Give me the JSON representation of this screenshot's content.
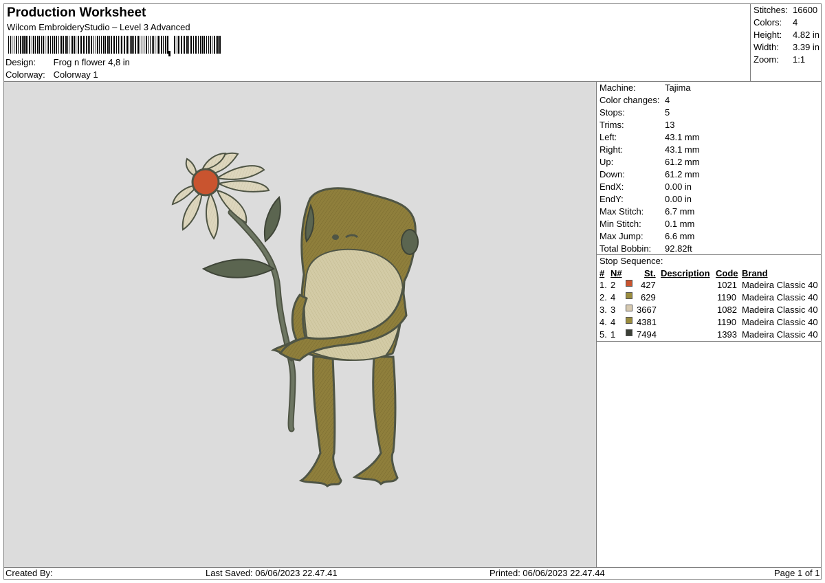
{
  "header": {
    "title": "Production Worksheet",
    "subtitle": "Wilcom EmbroideryStudio – Level 3 Advanced",
    "design_label": "Design:",
    "design_value": "Frog n flower 4,8 in",
    "colorway_label": "Colorway:",
    "colorway_value": "Colorway 1"
  },
  "summary": [
    {
      "label": "Stitches:",
      "value": "16600"
    },
    {
      "label": "Colors:",
      "value": "4"
    },
    {
      "label": "Height:",
      "value": "4.82 in"
    },
    {
      "label": "Width:",
      "value": "3.39 in"
    },
    {
      "label": "Zoom:",
      "value": "1:1"
    }
  ],
  "machine_info": [
    {
      "label": "Machine:",
      "value": "Tajima"
    },
    {
      "label": "Color changes:",
      "value": "4"
    },
    {
      "label": "Stops:",
      "value": "5"
    },
    {
      "label": "Trims:",
      "value": "13"
    },
    {
      "label": "Left:",
      "value": "43.1 mm"
    },
    {
      "label": "Right:",
      "value": "43.1 mm"
    },
    {
      "label": "Up:",
      "value": "61.2 mm"
    },
    {
      "label": "Down:",
      "value": "61.2 mm"
    },
    {
      "label": "EndX:",
      "value": "0.00 in"
    },
    {
      "label": "EndY:",
      "value": "0.00 in"
    },
    {
      "label": "Max Stitch:",
      "value": "6.7 mm"
    },
    {
      "label": "Min Stitch:",
      "value": "0.1 mm"
    },
    {
      "label": "Max Jump:",
      "value": "6.6 mm"
    },
    {
      "label": "Total Bobbin:",
      "value": "92.82ft"
    }
  ],
  "stop_sequence": {
    "title": "Stop Sequence:",
    "headers": {
      "num": "#",
      "n": "N#",
      "st": "St.",
      "description": "Description",
      "code": "Code",
      "brand": "Brand"
    },
    "rows": [
      {
        "num": "1.",
        "n": "2",
        "color": "#c9542f",
        "st": "427",
        "code": "1021",
        "brand": "Madeira Classic 40"
      },
      {
        "num": "2.",
        "n": "4",
        "color": "#9a8c3e",
        "st": "629",
        "code": "1190",
        "brand": "Madeira Classic 40"
      },
      {
        "num": "3.",
        "n": "3",
        "color": "#d6c9b0",
        "st": "3667",
        "code": "1082",
        "brand": "Madeira Classic 40"
      },
      {
        "num": "4.",
        "n": "4",
        "color": "#9a8c3e",
        "st": "4381",
        "code": "1190",
        "brand": "Madeira Classic 40"
      },
      {
        "num": "5.",
        "n": "1",
        "color": "#3b3f36",
        "st": "7494",
        "code": "1393",
        "brand": "Madeira Classic 40"
      }
    ]
  },
  "footer": {
    "created_by": "Created By:",
    "last_saved": "Last Saved: 06/06/2023 22.47.41",
    "printed": "Printed: 06/06/2023 22.47.44",
    "page": "Page 1 of 1"
  },
  "colors": {
    "canvas_bg": "#dcdcdc",
    "frog_body": "#8f7f3c",
    "frog_belly": "#d3cba6",
    "outline": "#4f5545",
    "petal": "#ddd6bd",
    "flower_center": "#c9542f",
    "stem": "#5b6550"
  }
}
